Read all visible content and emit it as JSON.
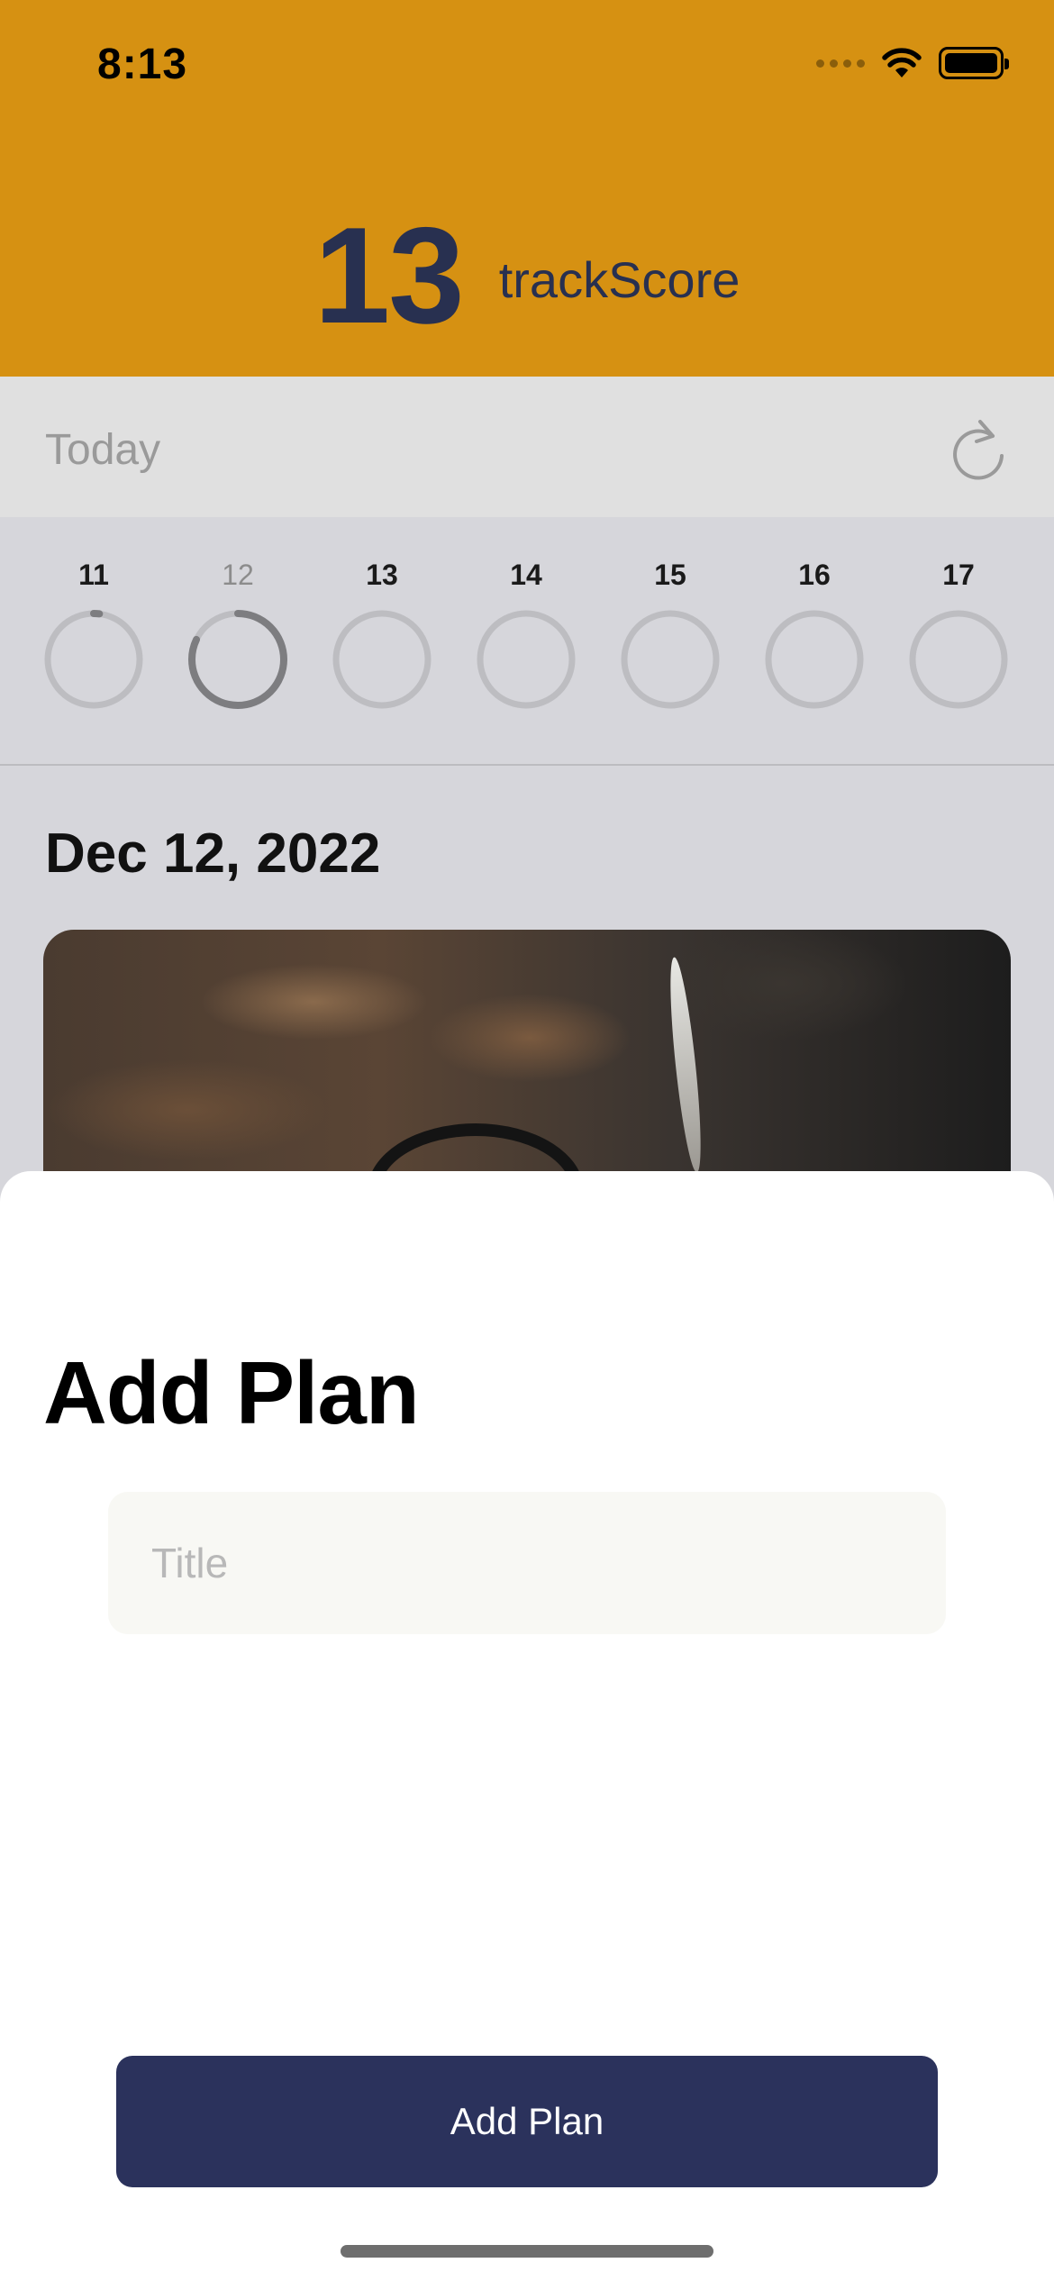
{
  "status_bar": {
    "time": "8:13",
    "icons": [
      "signal-dots-icon",
      "wifi-icon",
      "battery-icon"
    ]
  },
  "header": {
    "score": "13",
    "score_label": "trackScore",
    "background_color": "#d69112",
    "text_color": "#283050"
  },
  "today_bar": {
    "label": "Today",
    "refresh_icon": "refresh-icon"
  },
  "days": [
    {
      "num": "11",
      "progress": 0.02,
      "selected": false
    },
    {
      "num": "12",
      "progress": 0.82,
      "selected": true
    },
    {
      "num": "13",
      "progress": 0,
      "selected": false
    },
    {
      "num": "14",
      "progress": 0,
      "selected": false
    },
    {
      "num": "15",
      "progress": 0,
      "selected": false
    },
    {
      "num": "16",
      "progress": 0,
      "selected": false
    },
    {
      "num": "17",
      "progress": 0,
      "selected": false
    }
  ],
  "main": {
    "date": "Dec 12, 2022"
  },
  "sheet": {
    "title": "Add Plan",
    "title_field_placeholder": "Title",
    "title_field_value": "",
    "add_button_label": "Add Plan",
    "button_color": "#2b325c"
  }
}
